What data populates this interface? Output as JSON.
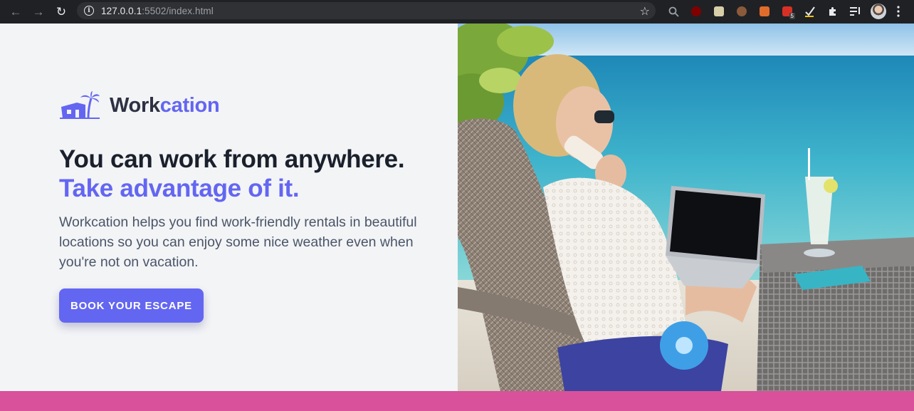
{
  "browser": {
    "back_icon": "arrow-left-icon",
    "forward_icon": "arrow-right-icon",
    "reload_icon": "reload-icon",
    "url_host": "127.0.0.1",
    "url_rest": ":5502/index.html",
    "extension_badge": "5"
  },
  "brand": {
    "name_part1": "Work",
    "name_part2": "cation",
    "accent_color": "#6366f1"
  },
  "hero": {
    "headline_line1": "You can work from anywhere.",
    "headline_line2": "Take advantage of it.",
    "description": "Workcation helps you find work-friendly rentals in beautiful locations so you can enjoy some nice weather even when you're not on vacation.",
    "cta_label": "BOOK YOUR ESCAPE"
  },
  "colors": {
    "footer_strip": "#d9519a",
    "heading": "#1a202c",
    "body_text": "#4a5568"
  }
}
